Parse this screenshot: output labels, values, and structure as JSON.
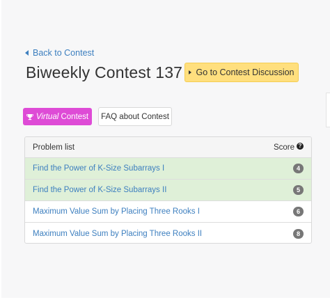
{
  "nav": {
    "back_label": "Back to Contest"
  },
  "contest": {
    "title": "Biweekly Contest 137",
    "discussion_label": "Go to Contest Discussion"
  },
  "actions": {
    "virtual_prefix": "Virtual",
    "virtual_suffix": " Contest",
    "faq_label": "FAQ about Contest"
  },
  "problems": {
    "header_label": "Problem list",
    "score_label": "Score",
    "rows": [
      {
        "name": "Find the Power of K-Size Subarrays I",
        "score": "4",
        "solved": true
      },
      {
        "name": "Find the Power of K-Size Subarrays II",
        "score": "5",
        "solved": true
      },
      {
        "name": "Maximum Value Sum by Placing Three Rooks I",
        "score": "6",
        "solved": false
      },
      {
        "name": "Maximum Value Sum by Placing Three Rooks II",
        "score": "8",
        "solved": false
      }
    ]
  },
  "colors": {
    "link": "#3d7fbf",
    "solved_row": "#dff0d8",
    "virtual_button": "#de4bd6",
    "discussion_button": "#ffdf7e"
  }
}
